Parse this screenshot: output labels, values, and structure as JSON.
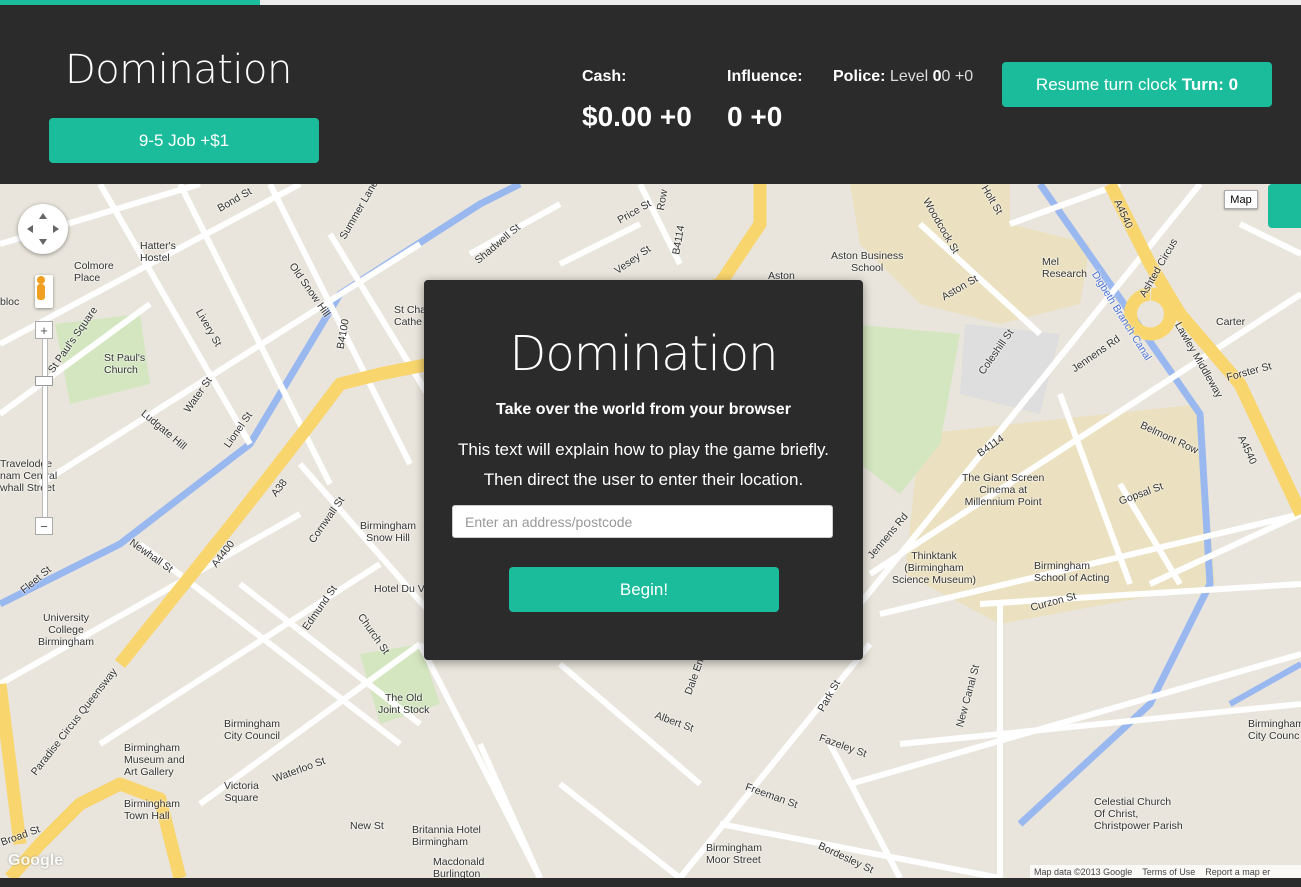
{
  "progress": {
    "fraction": 0.2
  },
  "header": {
    "title": "Domination",
    "job_button": "9-5 Job +$1",
    "cash_label": "Cash:",
    "cash_value": "$0.00 +0",
    "influence_label": "Influence:",
    "influence_value": "0 +0",
    "police_label": "Police:",
    "police_level_prefix": "Level ",
    "police_level_bold": "0",
    "police_level_rest": "0 +0",
    "resume_button": "Resume turn clock",
    "turn_label": "Turn: 0"
  },
  "dialog": {
    "title": "Domination",
    "tagline": "Take over the world from your browser",
    "line1": "This text will explain how to play the game briefly.",
    "line2": "Then direct the user to enter their location.",
    "address_placeholder": "Enter an address/postcode",
    "begin_button": "Begin!"
  },
  "map": {
    "type_button": "Map",
    "attribution_data": "Map data ©2013 Google",
    "attribution_terms": "Terms of Use",
    "attribution_report": "Report a map er",
    "logo": "Google",
    "zoom_in": "+",
    "zoom_out": "−",
    "labels": {
      "hatters": "Hatter's\nHostel",
      "colmore": "Colmore\nPlace",
      "bloc": "bloc",
      "stpauls_sq": "St Paul's Square",
      "stpauls_church": "St Paul's\nChurch",
      "old_snow_hill": "Old Snow Hill",
      "livery": "Livery St",
      "water": "Water St",
      "ludgate": "Ludgate Hill",
      "lionel": "Lionel St",
      "travelodge": "Travelodge\nnam Central\nwhall Street",
      "newhall": "Newhall St",
      "fleet": "Fleet St",
      "university": "University\nCollege\nBirmingham",
      "paradise": "Paradise Circus Queensway",
      "a38": "A38",
      "a4400": "A4400",
      "bham_snowhill": "Birmingham\nSnow Hill",
      "hotel_du_vin": "Hotel Du V",
      "cornwall": "Cornwall St",
      "edmund": "Edmund St",
      "church": "Church St",
      "old_joint_stock": "The Old\nJoint Stock",
      "council": "Birmingham\nCity Council",
      "museum": "Birmingham\nMuseum and\nArt Gallery",
      "victoria_sq": "Victoria\nSquare",
      "town_hall": "Birmingham\nTown Hall",
      "waterloo": "Waterloo St",
      "new_st": "New St",
      "britannia": "Britannia Hotel\nBirmingham",
      "macdonald": "Macdonald\nBurlington",
      "broad_st": "Broad St",
      "moor_street": "Birmingham\nMoor Street",
      "bordesley": "Bordesley St",
      "aston_business": "Aston Business\nSchool",
      "aston": "Aston",
      "aston_st": "Aston St",
      "coleshill": "Coleshill St",
      "mel_research": "Mel\nResearch",
      "ashted_circus": "Ashted Circus",
      "lawley": "Lawley Middleway",
      "a4540_top": "A4540",
      "a4540_right": "A4540",
      "carter": "Carter",
      "jennens_top": "Jennens Rd",
      "jennens_bottom": "Jennens Rd",
      "digbeth": "Digbeth Branch Canal",
      "giant_screen": "The Giant Screen\nCinema at\nMillennium Point",
      "thinktank": "Thinktank\n(Birmingham\nScience Museum)",
      "school_acting": "Birmingham\nSchool of Acting",
      "curzon": "Curzon St",
      "belmont": "Belmont Row",
      "gopsal": "Gopsal St",
      "b4114": "B4114",
      "forster": "Forster St",
      "fazeley": "Fazeley St",
      "freeman": "Freeman St",
      "celestial": "Celestial Church\nOf Christ,\nChristpower Parish",
      "council_right": "Birmingham\nCity Counc",
      "new_canal": "New Canal St",
      "park_st": "Park St",
      "albert": "Albert St",
      "dale_end": "Dale End",
      "woodcock": "Woodcock St",
      "holt": "Holt St",
      "b4100": "B4100",
      "b4114_top": "B4114",
      "row": "Row",
      "price_st": "Price St",
      "vesey": "Vesey St",
      "shadwell": "Shadwell St",
      "bond": "Bond St",
      "summer_lane": "Summer Lane",
      "st_chads": "St Cha\nCathe"
    }
  }
}
